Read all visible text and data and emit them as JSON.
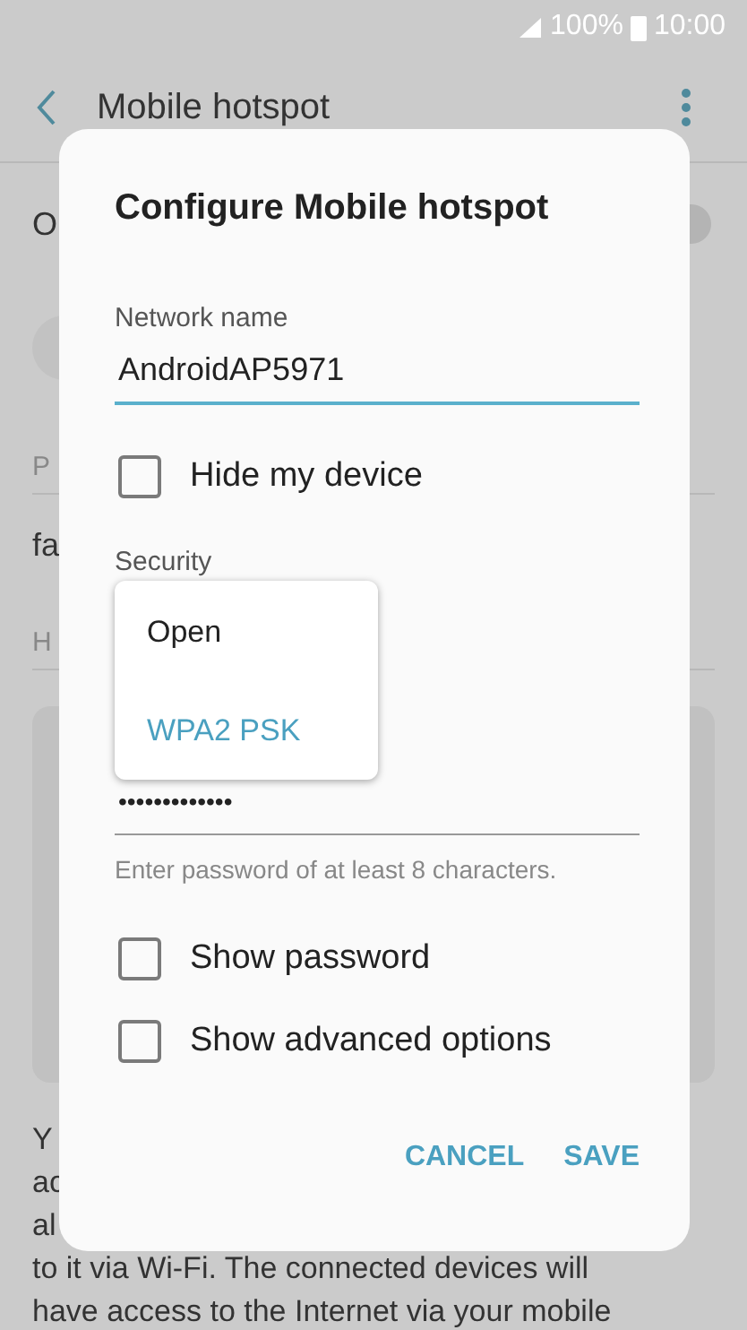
{
  "status_bar": {
    "battery": "100%",
    "time": "10:00"
  },
  "header": {
    "title": "Mobile hotspot"
  },
  "background": {
    "rows": [
      {
        "kind": "switch",
        "text": "O",
        "on": false
      },
      {
        "kind": "avatar"
      },
      {
        "kind": "label",
        "text": "P"
      },
      {
        "kind": "value",
        "text": "fa"
      },
      {
        "kind": "label",
        "text": "H"
      },
      {
        "kind": "card"
      }
    ],
    "paragraph_lines": [
      "Y",
      "ac",
      "al",
      "to it via Wi-Fi. The connected devices will",
      "have access to the Internet via your mobile"
    ]
  },
  "dialog": {
    "title": "Configure Mobile hotspot",
    "items": [
      {
        "kind": "field",
        "label": "Network name",
        "value": "AndroidAP5971",
        "focused": true
      },
      {
        "kind": "checkbox",
        "label": "Hide my device",
        "checked": false
      },
      {
        "kind": "select",
        "label": "Security",
        "options": [
          {
            "label": "Open",
            "selected": false
          },
          {
            "label": "WPA2 PSK",
            "selected": true
          }
        ]
      },
      {
        "kind": "password",
        "value": "•••••••••••••",
        "hint": "Enter password of at least 8 characters."
      },
      {
        "kind": "checkbox",
        "label": "Show password",
        "checked": false
      },
      {
        "kind": "checkbox",
        "label": "Show advanced options",
        "checked": false
      }
    ],
    "buttons": [
      "CANCEL",
      "SAVE"
    ]
  }
}
